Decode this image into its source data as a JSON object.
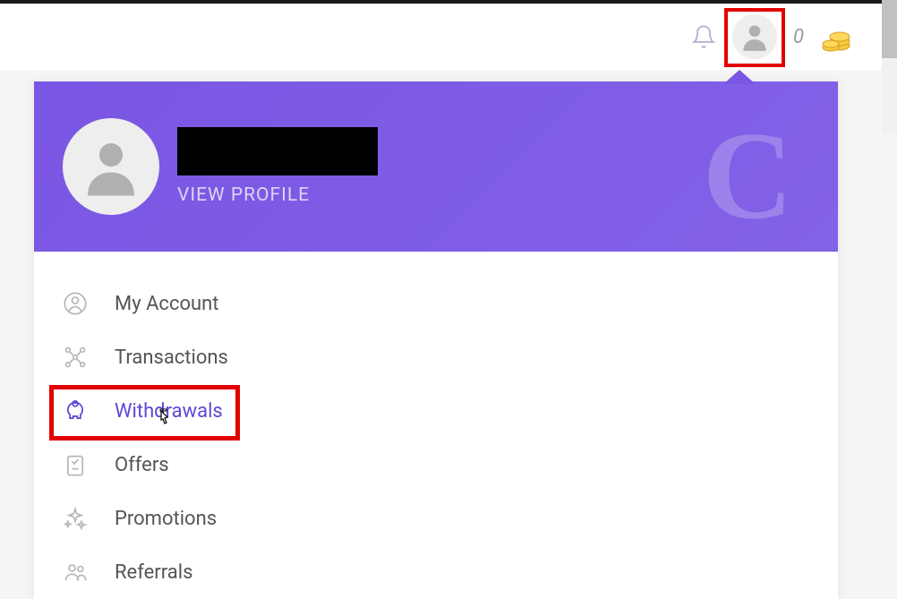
{
  "header": {
    "coin_count": "0"
  },
  "profile": {
    "view_profile_label": "VIEW PROFILE",
    "bg_letter": "C"
  },
  "menu": {
    "items": [
      {
        "label": "My Account",
        "icon": "user-circle-icon"
      },
      {
        "label": "Transactions",
        "icon": "network-icon"
      },
      {
        "label": "Withdrawals",
        "icon": "piggy-bank-icon",
        "active": true
      },
      {
        "label": "Offers",
        "icon": "checklist-icon"
      },
      {
        "label": "Promotions",
        "icon": "sparkle-icon"
      },
      {
        "label": "Referrals",
        "icon": "people-icon"
      }
    ]
  }
}
